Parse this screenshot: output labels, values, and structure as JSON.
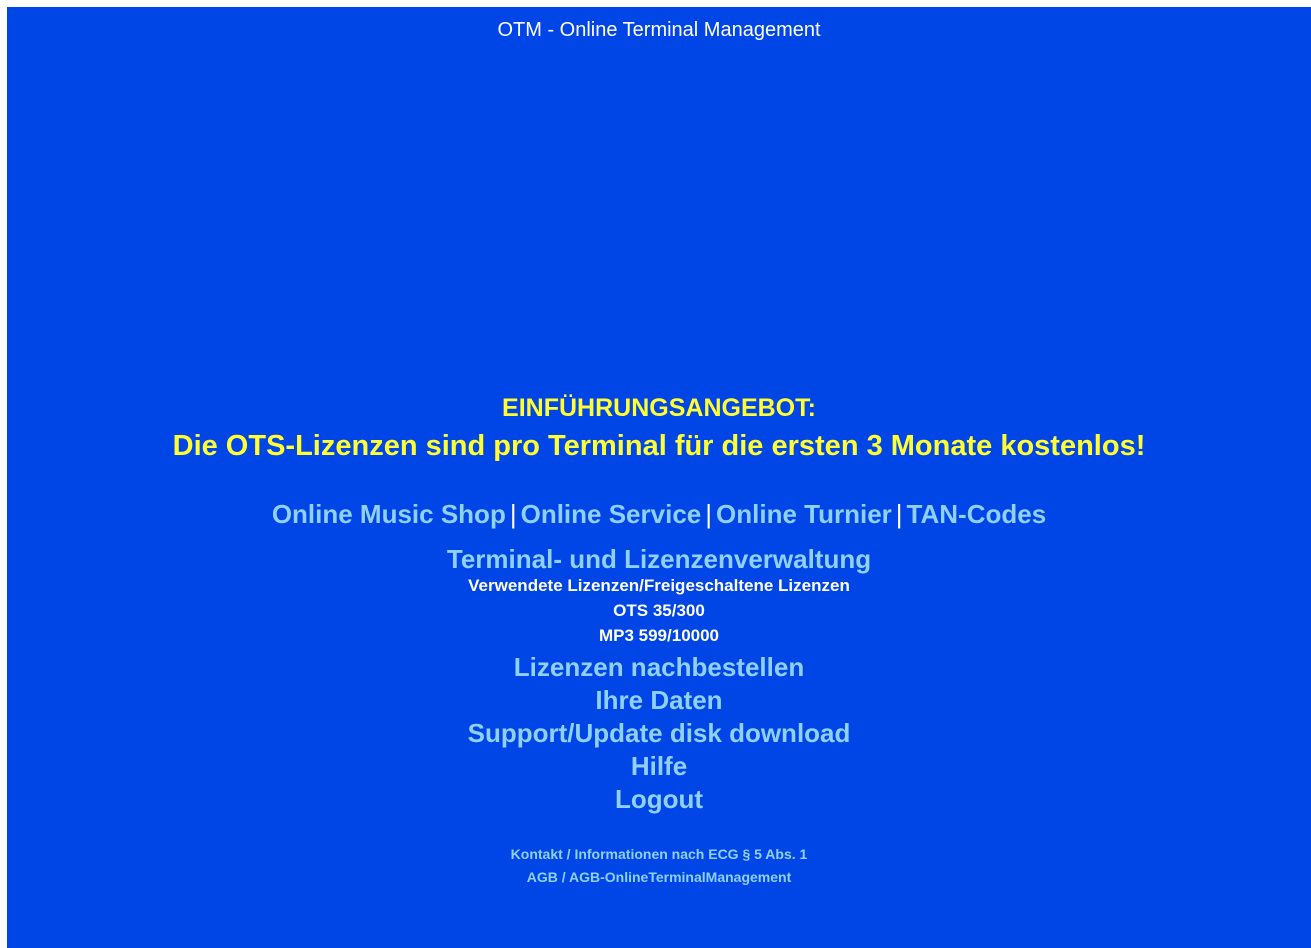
{
  "page": {
    "title": "OTM - Online Terminal Management",
    "background_color": "#0045e6",
    "accent_yellow": "#ffff33",
    "link_color": "#8fd0ff"
  },
  "promo": {
    "heading": "EINFÜHRUNGSANGEBOT:",
    "text": "Die OTS-Lizenzen sind pro Terminal für die ersten 3 Monate kostenlos!"
  },
  "top_nav": {
    "items": [
      {
        "label": "Online Music Shop"
      },
      {
        "label": "Online Service"
      },
      {
        "label": "Online Turnier"
      },
      {
        "label": "TAN-Codes"
      }
    ],
    "separator": "|"
  },
  "menu": {
    "terminal_management": "Terminal- und Lizenzenverwaltung",
    "license_caption": "Verwendete Lizenzen/Freigeschaltene Lizenzen",
    "ots_licenses": "OTS 35/300",
    "mp3_licenses": "MP3 599/10000",
    "reorder_licenses": "Lizenzen nachbestellen",
    "your_data": "Ihre Daten",
    "support_download": "Support/Update disk download",
    "help": "Hilfe",
    "logout": "Logout"
  },
  "footer": {
    "contact": "Kontakt / Informationen nach ECG § 5 Abs. 1",
    "terms": "AGB / AGB-OnlineTerminalManagement"
  }
}
